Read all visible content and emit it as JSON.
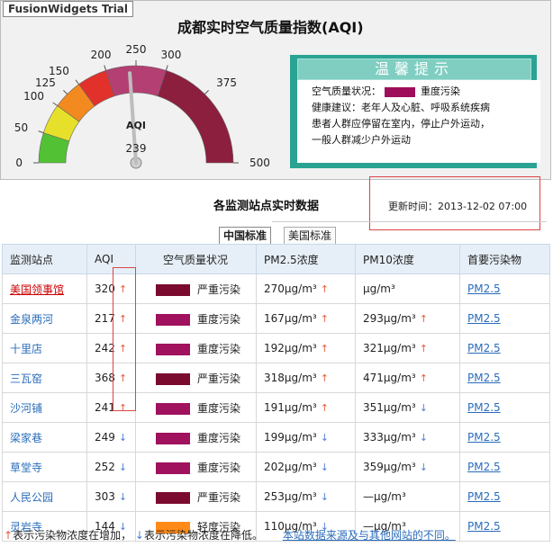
{
  "trial_label": "FusionWidgets Trial",
  "main_title": "成都实时空气质量指数(AQI)",
  "gauge": {
    "ticks": [
      "0",
      "50",
      "100",
      "125",
      "150",
      "200",
      "250",
      "300",
      "375",
      "500"
    ],
    "label": "AQI",
    "value_text": "239",
    "value": 239,
    "min": 0,
    "max": 500
  },
  "tip": {
    "title": "温馨提示",
    "status_label": "空气质量状况：",
    "status_color": "#9e0e5a",
    "status_text": "重度污染",
    "advice_line1": "健康建议：老年人及心脏、呼吸系统疾病",
    "advice_line2": "患者人群应停留在室内，停止户外运动，",
    "advice_line3": "一般人群减少户外运动"
  },
  "section_title": "各监测站点实时数据",
  "update_time": "更新时间：2013-12-02 07:00",
  "tabs": [
    {
      "label": "中国标准",
      "active": true
    },
    {
      "label": "美国标准",
      "active": false
    }
  ],
  "table": {
    "headers": [
      "监测站点",
      "AQI",
      "空气质量状况",
      "PM2.5浓度",
      "PM10浓度",
      "首要污染物"
    ],
    "rows": [
      {
        "site": "美国领事馆",
        "aqi": "320",
        "aqi_trend": "up",
        "quality_color": "#7a0b2e",
        "quality": "严重污染",
        "pm25": "270μg/m³",
        "pm25_trend": "up",
        "pm10": "μg/m³",
        "pm10_trend": "",
        "primary": "PM2.5"
      },
      {
        "site": "金泉两河",
        "aqi": "217",
        "aqi_trend": "up",
        "quality_color": "#a0115e",
        "quality": "重度污染",
        "pm25": "167μg/m³",
        "pm25_trend": "up",
        "pm10": "293μg/m³",
        "pm10_trend": "up",
        "primary": "PM2.5"
      },
      {
        "site": "十里店",
        "aqi": "242",
        "aqi_trend": "up",
        "quality_color": "#a0115e",
        "quality": "重度污染",
        "pm25": "192μg/m³",
        "pm25_trend": "up",
        "pm10": "321μg/m³",
        "pm10_trend": "up",
        "primary": "PM2.5"
      },
      {
        "site": "三瓦窑",
        "aqi": "368",
        "aqi_trend": "up",
        "quality_color": "#7a0b2e",
        "quality": "严重污染",
        "pm25": "318μg/m³",
        "pm25_trend": "up",
        "pm10": "471μg/m³",
        "pm10_trend": "up",
        "primary": "PM2.5"
      },
      {
        "site": "沙河铺",
        "aqi": "241",
        "aqi_trend": "up",
        "quality_color": "#a0115e",
        "quality": "重度污染",
        "pm25": "191μg/m³",
        "pm25_trend": "up",
        "pm10": "351μg/m³",
        "pm10_trend": "down",
        "primary": "PM2.5"
      },
      {
        "site": "梁家巷",
        "aqi": "249",
        "aqi_trend": "down",
        "quality_color": "#a0115e",
        "quality": "重度污染",
        "pm25": "199μg/m³",
        "pm25_trend": "down",
        "pm10": "333μg/m³",
        "pm10_trend": "down",
        "primary": "PM2.5"
      },
      {
        "site": "草堂寺",
        "aqi": "252",
        "aqi_trend": "down",
        "quality_color": "#a0115e",
        "quality": "重度污染",
        "pm25": "202μg/m³",
        "pm25_trend": "down",
        "pm10": "359μg/m³",
        "pm10_trend": "down",
        "primary": "PM2.5"
      },
      {
        "site": "人民公园",
        "aqi": "303",
        "aqi_trend": "down",
        "quality_color": "#7a0b2e",
        "quality": "严重污染",
        "pm25": "253μg/m³",
        "pm25_trend": "down",
        "pm10": "—μg/m³",
        "pm10_trend": "",
        "primary": "PM2.5"
      },
      {
        "site": "灵岩寺",
        "aqi": "144",
        "aqi_trend": "down",
        "quality_color": "#ff8a17",
        "quality": "轻度污染",
        "pm25": "110μg/m³",
        "pm25_trend": "down",
        "pm10": "—μg/m³",
        "pm10_trend": "",
        "primary": "PM2.5"
      }
    ]
  },
  "footer": {
    "up_text": "表示污染物浓度在增加，",
    "down_text": "表示污染物浓度在降低。",
    "link": "本站数据来源及与其他网站的不同。"
  },
  "colors": {
    "trend_up": "#e45b3c",
    "trend_down": "#4d7fd0",
    "tip_bg": "#2aa393"
  }
}
